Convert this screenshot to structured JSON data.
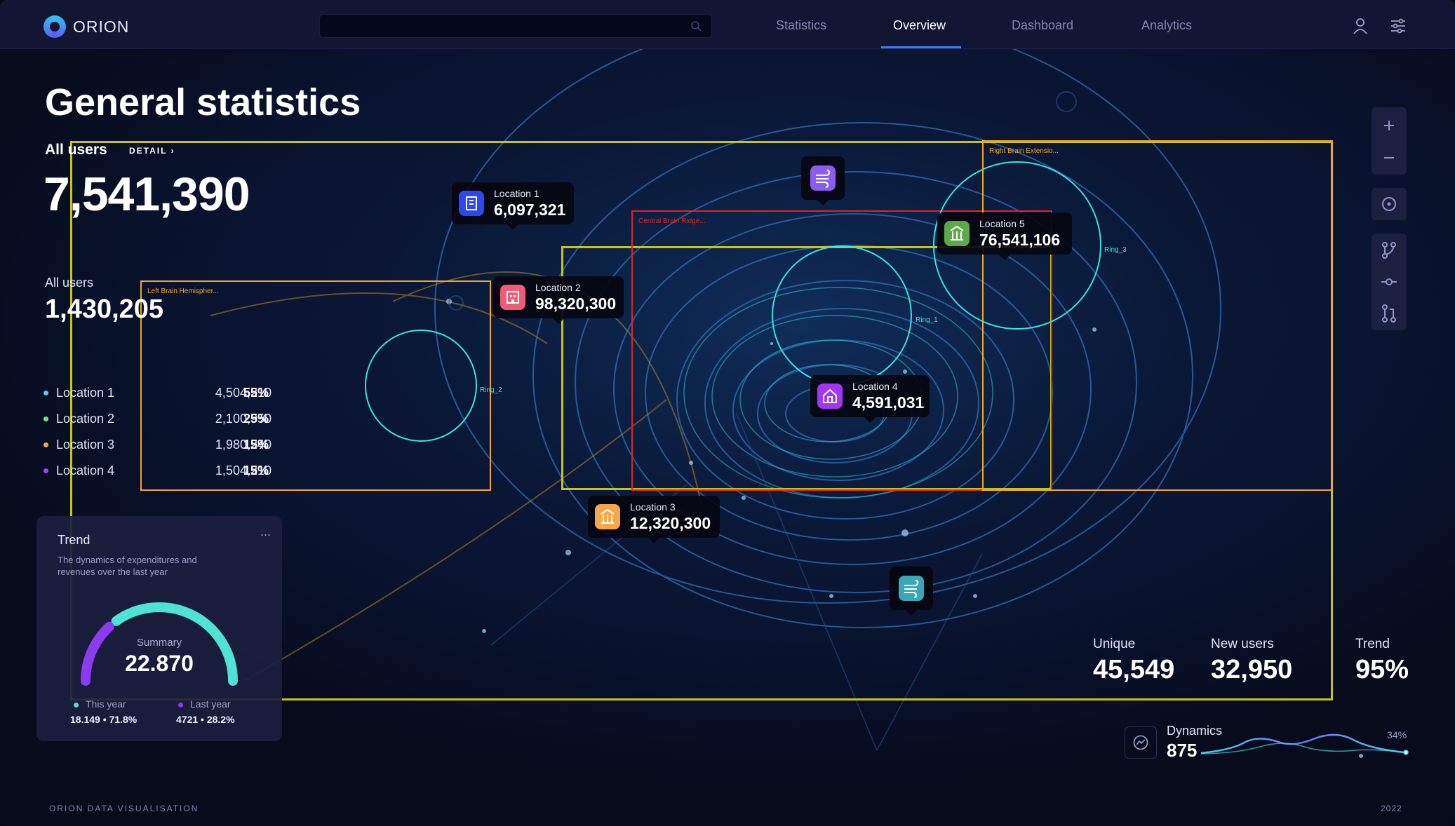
{
  "app": {
    "name": "ORION"
  },
  "search": {
    "placeholder": ""
  },
  "nav": {
    "tabs": [
      {
        "label": "Statistics"
      },
      {
        "label": "Overview"
      },
      {
        "label": "Dashboard"
      },
      {
        "label": "Analytics"
      }
    ],
    "active_tab": "Overview"
  },
  "header": {
    "title": "General statistics",
    "all_users_label": "All users",
    "detail_label": "DETAIL",
    "all_users_value": "7,541,390"
  },
  "summary": {
    "label": "All users",
    "value": "1,430,205",
    "locations": [
      {
        "name": "Location 1",
        "value": "4,504,210",
        "pct": "55%",
        "color": "#5ec8f2"
      },
      {
        "name": "Location 2",
        "value": "2,100,950",
        "pct": "25%",
        "color": "#7be37b"
      },
      {
        "name": "Location 3",
        "value": "1,980,240",
        "pct": "15%",
        "color": "#f5a74a"
      },
      {
        "name": "Location 4",
        "value": "1,504,210",
        "pct": "15%",
        "color": "#a246f0"
      }
    ]
  },
  "trend_card": {
    "title": "Trend",
    "menu": "...",
    "description": "The dynamics of expenditures and revenues over the last year",
    "summary_label": "Summary",
    "summary_value": "22.870",
    "this_year_label": "This year",
    "this_year_value": "18.149  • 71.8%",
    "last_year_label": "Last year",
    "last_year_value": "4721  •  28.2%",
    "this_year_share": 0.718,
    "last_year_share": 0.282,
    "this_year_color": "#4fe3d6",
    "last_year_color": "#8b3cf0"
  },
  "map": {
    "regions": [
      {
        "label": "Left Brain Hemispher...",
        "color": "#f5a623"
      },
      {
        "label": "Central Brain Ridge...",
        "color": "#e0241f"
      },
      {
        "label": "Right Brain Extensio...",
        "color": "#f5a623"
      }
    ],
    "rings": [
      {
        "label": "Ring_1"
      },
      {
        "label": "Ring_2"
      },
      {
        "label": "Ring_3"
      }
    ],
    "pins": [
      {
        "label": "Location 1",
        "value": "6,097,321",
        "color": "#2e48f0",
        "icon": "building-icon"
      },
      {
        "label": "Location 2",
        "value": "98,320,300",
        "color": "#ee5d78",
        "icon": "office-icon"
      },
      {
        "label": "Location 3",
        "value": "12,320,300",
        "color": "#f5a74a",
        "icon": "bank-icon"
      },
      {
        "label": "Location 4",
        "value": "4,591,031",
        "color": "#a236f5",
        "icon": "house-icon"
      },
      {
        "label": "Location 5",
        "value": "76,541,106",
        "color": "#5ea84a",
        "icon": "bank-icon"
      }
    ],
    "wind_pins": [
      {
        "icon": "wind-icon",
        "color": "#8b5cf0"
      },
      {
        "icon": "wind-icon",
        "color": "#3aa7b5"
      }
    ]
  },
  "tools": [
    "zoom-in-icon",
    "zoom-out-icon",
    "locate-icon",
    "branch-icon",
    "commit-icon",
    "pull-request-icon"
  ],
  "stats": {
    "unique_label": "Unique",
    "unique_value": "45,549",
    "new_users_label": "New users",
    "new_users_value": "32,950",
    "trend_label": "Trend",
    "trend_value": "95%"
  },
  "dynamics": {
    "label": "Dynamics",
    "value": "875",
    "pct": "34%"
  },
  "footer": {
    "left": "ORION DATA VISUALISATION",
    "right": "2022"
  }
}
